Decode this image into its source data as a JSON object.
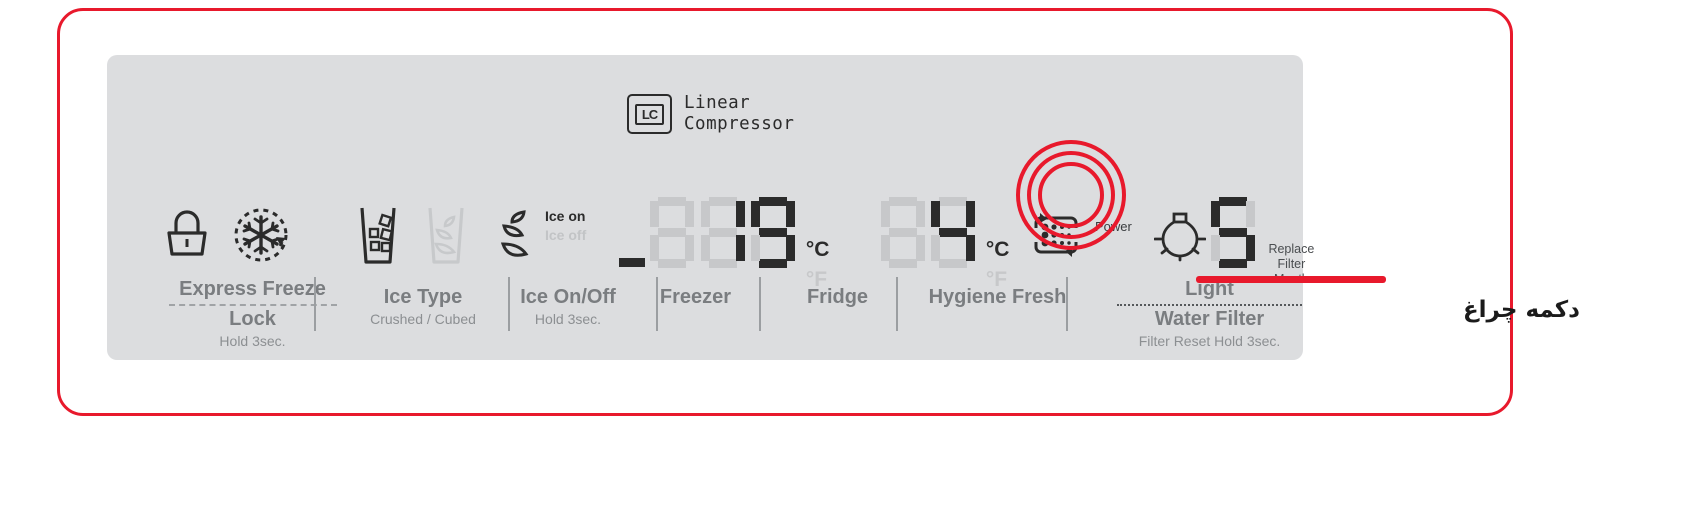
{
  "device": {
    "type": "refrigerator-control-panel",
    "brand_badge": {
      "logo_text": "LC",
      "line1": "Linear",
      "line2": "Compressor"
    }
  },
  "colors": {
    "panel_background": "#dcdddf",
    "page_background": "#ffffff",
    "annotation_red": "#e8192c",
    "label_gray": "#7a7d80",
    "segment_on": "#2b2b2b",
    "segment_off": "#c7c8ca"
  },
  "controls": [
    {
      "id": "express-freeze-lock",
      "icons": [
        "lock-icon",
        "express-freeze-snowflake-icon"
      ],
      "label_main": "Express Freeze",
      "label_alt": "Lock",
      "label_sub": "Hold 3sec.",
      "divider": "dashed"
    },
    {
      "id": "ice-type",
      "icons": [
        "crushed-ice-glass-icon",
        "cubed-ice-glass-icon"
      ],
      "label_main": "Ice Type",
      "label_sub": "Crushed / Cubed",
      "divider": "none"
    },
    {
      "id": "ice-on-off",
      "icons": [
        "ice-maker-icon"
      ],
      "label_main": "Ice On/Off",
      "label_sub": "Hold 3sec.",
      "state_on": "Ice on",
      "state_off": "Ice off",
      "active_state": "Ice on",
      "divider": "none"
    },
    {
      "id": "freezer",
      "label_main": "Freezer",
      "label_sub": "",
      "divider": "none"
    },
    {
      "id": "fridge",
      "label_main": "Fridge",
      "label_sub": "",
      "divider": "none"
    },
    {
      "id": "hygiene-fresh",
      "icons": [
        "hygiene-fresh-filter-icon"
      ],
      "label_main": "Hygiene Fresh",
      "label_sub": "",
      "indicator": "Power",
      "divider": "none"
    },
    {
      "id": "light-water-filter",
      "icons": [
        "light-bulb-icon"
      ],
      "label_main": "Light",
      "label_alt": "Water Filter",
      "label_sub": "Filter Reset Hold 3sec.",
      "divider": "dotted"
    }
  ],
  "displays": {
    "freezer": {
      "sign": "-",
      "digit1": "8",
      "digit1_state": "off",
      "digit2": "1",
      "digit3": "9",
      "value": "-19",
      "unit_active": "°C",
      "unit_inactive": "°F"
    },
    "fridge": {
      "digit1": "8",
      "digit1_state": "off",
      "digit2": "4",
      "value": "4",
      "unit_active": "°C",
      "unit_inactive": "°F"
    },
    "filter": {
      "digit": "5",
      "line1": "Replace",
      "line2": "Filter",
      "line3": "Month"
    }
  },
  "annotation": {
    "caption": "دکمه چراغ",
    "target": "Light",
    "highlight_shape": "concentric-rings",
    "ring_count": 3
  }
}
